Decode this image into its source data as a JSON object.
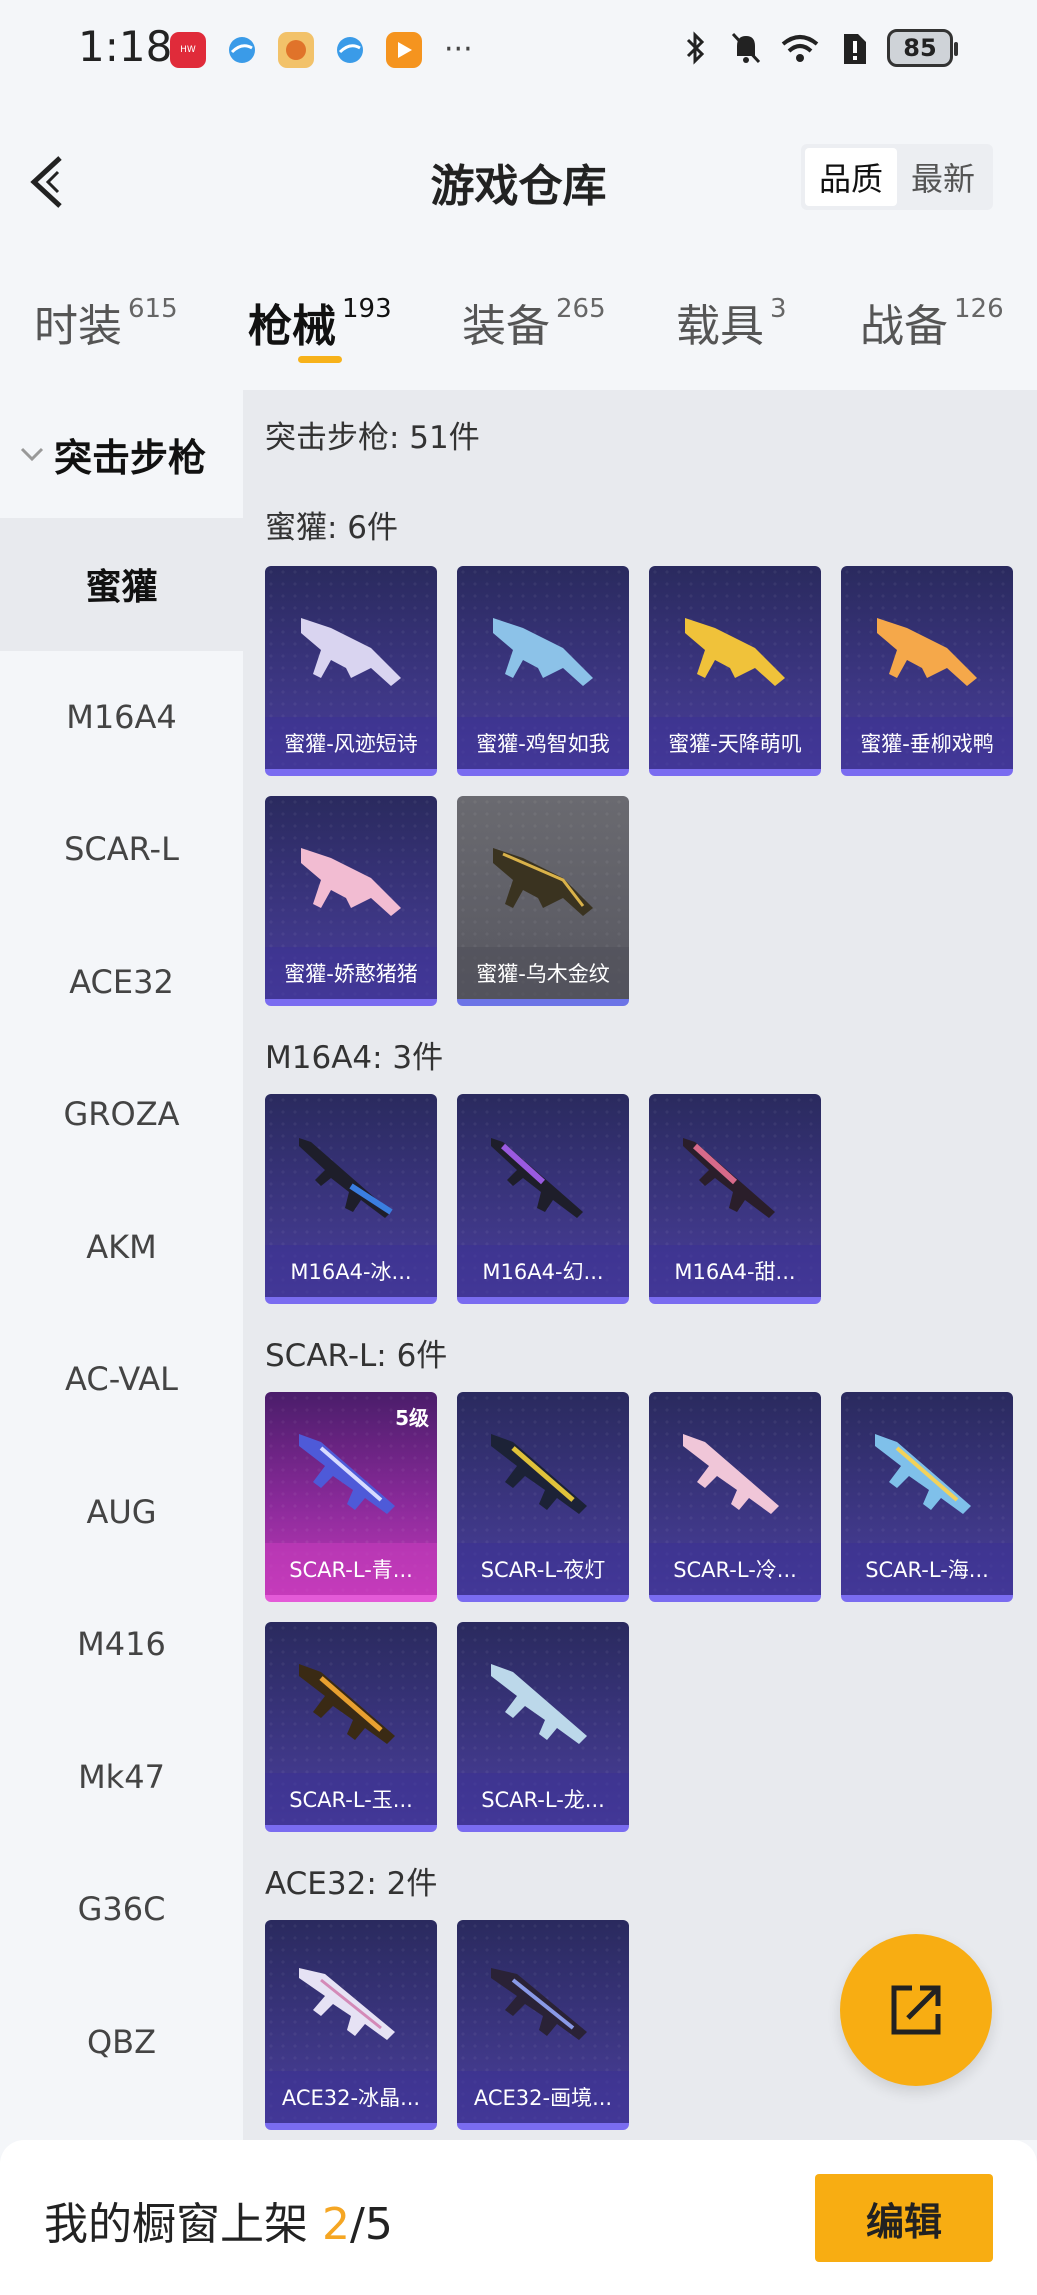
{
  "status_bar": {
    "time": "1:18",
    "battery": "85",
    "more": "···"
  },
  "header": {
    "title": "游戏仓库",
    "sort_options": [
      "品质",
      "最新"
    ],
    "active_sort": "品质"
  },
  "tabs": [
    {
      "label": "时装",
      "count": "615"
    },
    {
      "label": "枪械",
      "count": "193",
      "active": true
    },
    {
      "label": "装备",
      "count": "265"
    },
    {
      "label": "载具",
      "count": "3"
    },
    {
      "label": "战备",
      "count": "126"
    }
  ],
  "sidebar": {
    "heading": "突击步枪",
    "items": [
      "蜜獾",
      "M16A4",
      "SCAR-L",
      "ACE32",
      "GROZA",
      "AKM",
      "AC-VAL",
      "AUG",
      "M416",
      "Mk47",
      "G36C",
      "QBZ"
    ],
    "active": "蜜獾"
  },
  "content": {
    "summary": "突击步枪: 51件",
    "sections": [
      {
        "title": "蜜獾: 6件",
        "items": [
          {
            "name": "蜜獾-风迹短诗"
          },
          {
            "name": "蜜獾-鸡智如我"
          },
          {
            "name": "蜜獾-天降萌叽"
          },
          {
            "name": "蜜獾-垂柳戏鸭"
          },
          {
            "name": "蜜獾-娇憨猪猪"
          },
          {
            "name": "蜜獾-乌木金纹"
          }
        ]
      },
      {
        "title": "M16A4: 3件",
        "items": [
          {
            "name": "M16A4-冰..."
          },
          {
            "name": "M16A4-幻..."
          },
          {
            "name": "M16A4-甜..."
          }
        ]
      },
      {
        "title": "SCAR-L: 6件",
        "items": [
          {
            "name": "SCAR-L-青...",
            "badge": "5级"
          },
          {
            "name": "SCAR-L-夜灯"
          },
          {
            "name": "SCAR-L-冷..."
          },
          {
            "name": "SCAR-L-海..."
          },
          {
            "name": "SCAR-L-玉..."
          },
          {
            "name": "SCAR-L-龙..."
          }
        ]
      },
      {
        "title": "ACE32: 2件",
        "items": [
          {
            "name": "ACE32-冰晶..."
          },
          {
            "name": "ACE32-画境..."
          }
        ]
      }
    ]
  },
  "bottom_bar": {
    "label": "我的橱窗上架",
    "current": "2",
    "sep_total": "/5",
    "edit_label": "编辑"
  },
  "colors": {
    "accent": "#f8ad12",
    "card_base": "#3b3580",
    "card_rare": "#c13ab8"
  }
}
